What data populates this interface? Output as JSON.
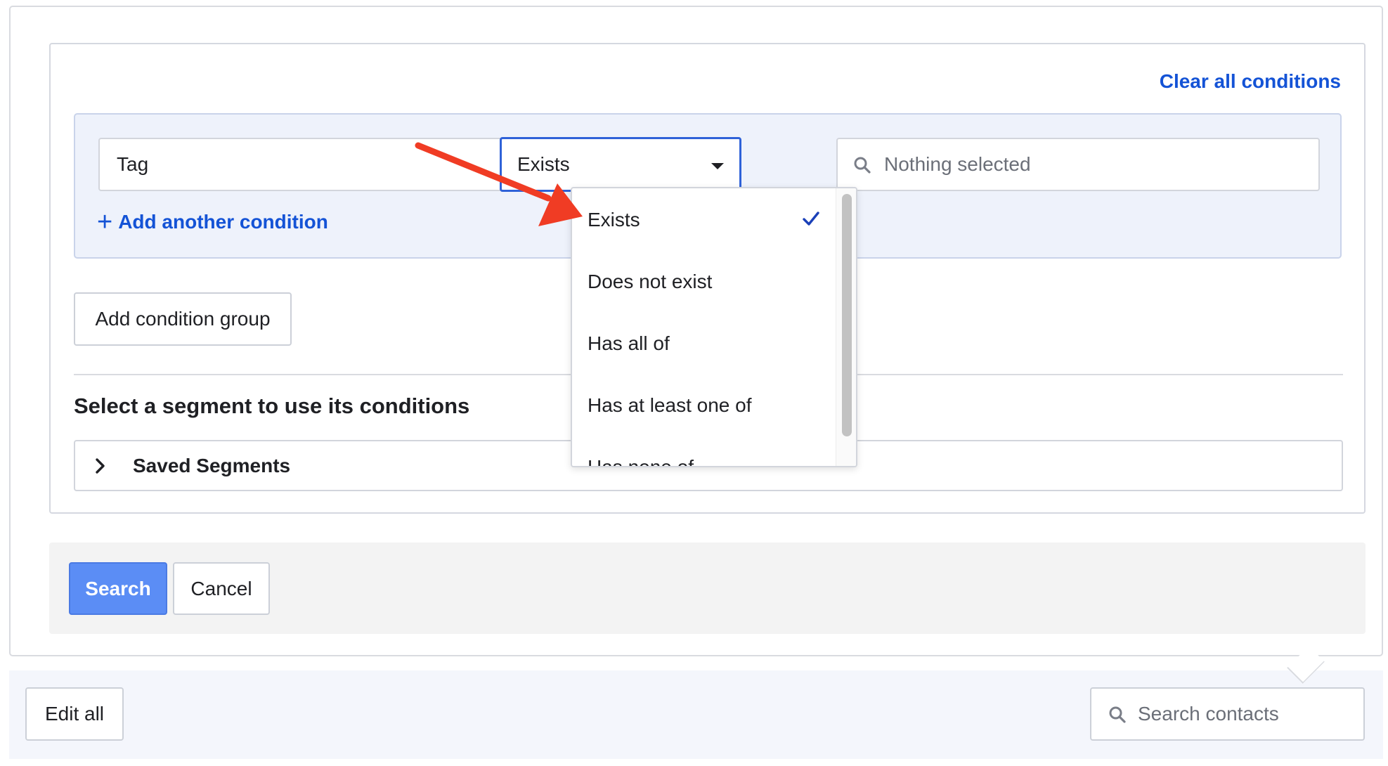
{
  "builder": {
    "clear_all_label": "Clear all conditions",
    "condition": {
      "field_value": "Tag",
      "operator_value": "Exists",
      "value_placeholder": "Nothing selected"
    },
    "add_condition_label": "Add another condition",
    "add_group_label": "Add condition group",
    "segment_heading": "Select a segment to use its conditions",
    "saved_segments_label": "Saved Segments"
  },
  "dropdown": {
    "options": [
      "Exists",
      "Does not exist",
      "Has all of",
      "Has at least one of",
      "Has none of"
    ],
    "selected": "Exists"
  },
  "actions": {
    "search_label": "Search",
    "cancel_label": "Cancel"
  },
  "toolbar": {
    "edit_all_label": "Edit all",
    "search_placeholder": "Search contacts"
  },
  "icons": {
    "clear": "close-icon",
    "caret": "caret-down-icon",
    "search": "search-icon",
    "chevron": "chevron-right-icon",
    "check": "check-icon"
  },
  "colors": {
    "link": "#1453d6",
    "primary_button": "#5b8df5",
    "group_bg": "#eef2fb",
    "annotation_arrow": "#f03c24"
  }
}
